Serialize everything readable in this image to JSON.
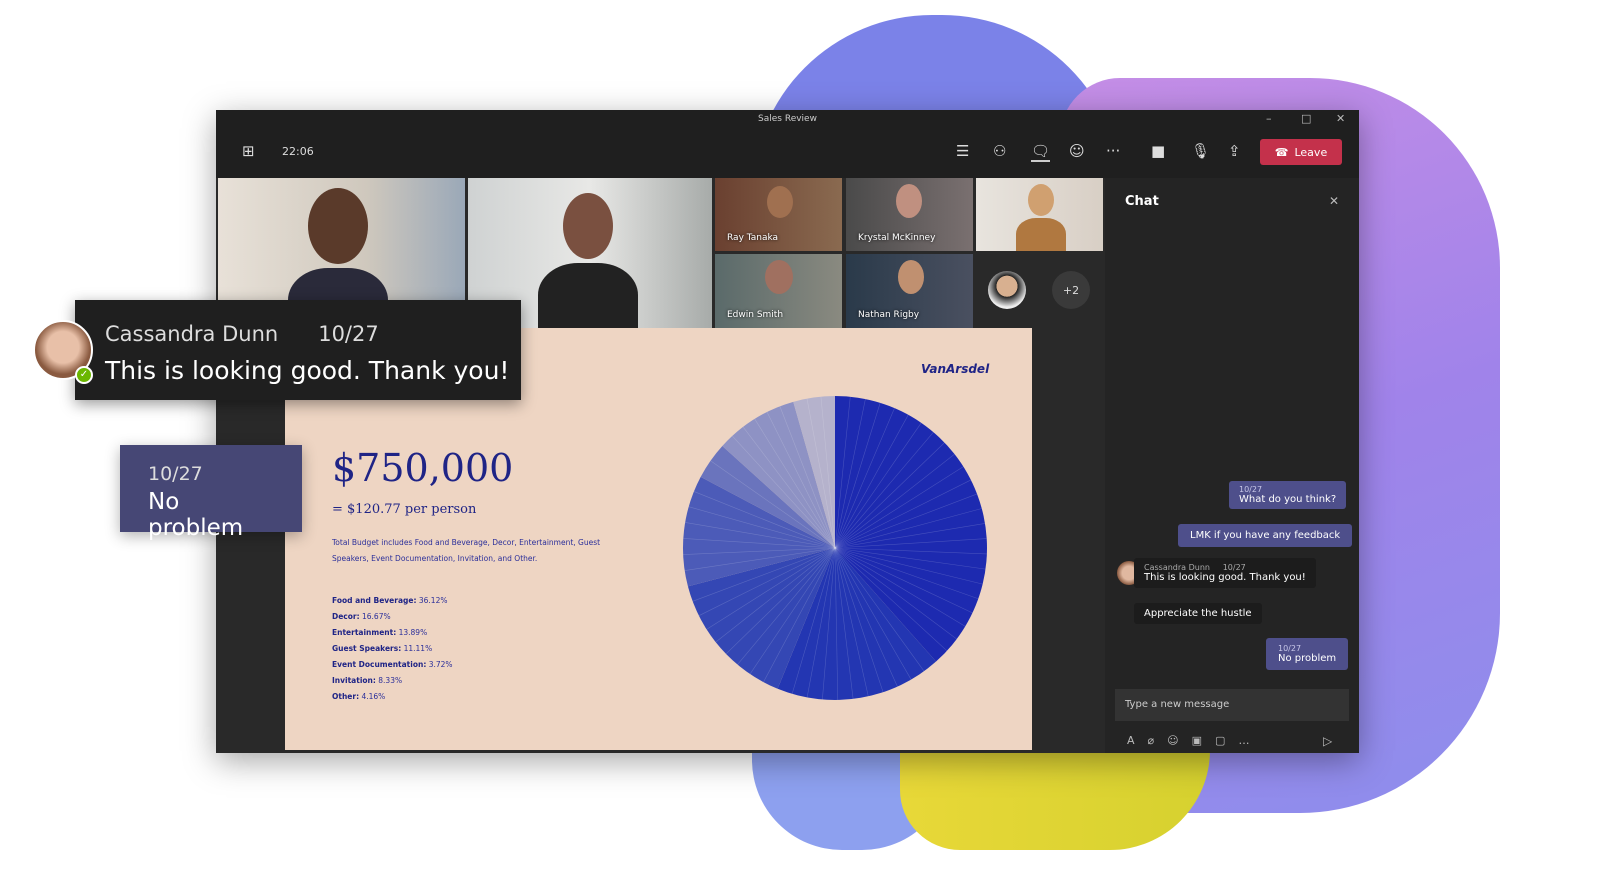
{
  "window": {
    "title": "Sales Review",
    "minimize": "–",
    "maximize": "□",
    "close": "✕"
  },
  "toolbar": {
    "timer": "22:06",
    "leave_label": "Leave",
    "more": "···"
  },
  "participants": [
    {
      "name": ""
    },
    {
      "name": ""
    },
    {
      "name": "Ray Tanaka"
    },
    {
      "name": "Krystal McKinney"
    },
    {
      "name": ""
    },
    {
      "name": "Edwin Smith"
    },
    {
      "name": "Nathan Rigby"
    }
  ],
  "overflow_count": "+2",
  "slide": {
    "brand": "VanArsdel",
    "total": "$750,000",
    "per_person": "= $120.77 per person",
    "description": "Total Budget includes Food and Beverage, Decor, Entertainment, Guest Speakers, Event Documentation, Invitation, and Other.",
    "legend": [
      {
        "label": "Food and Beverage:",
        "value": "36.12%"
      },
      {
        "label": "Decor:",
        "value": "16.67%"
      },
      {
        "label": "Entertainment:",
        "value": "13.89%"
      },
      {
        "label": "Guest Speakers:",
        "value": "11.11%"
      },
      {
        "label": "Event Documentation:",
        "value": "3.72%"
      },
      {
        "label": "Invitation:",
        "value": "8.33%"
      },
      {
        "label": "Other:",
        "value": "4.16%"
      }
    ]
  },
  "chart_data": {
    "type": "pie",
    "categories": [
      "Food and Beverage",
      "Decor",
      "Entertainment",
      "Guest Speakers",
      "Event Documentation",
      "Invitation",
      "Other"
    ],
    "values": [
      36.12,
      16.67,
      13.89,
      11.11,
      3.72,
      8.33,
      4.16
    ],
    "colors": [
      "#1d2ab0",
      "#2336b2",
      "#3447b4",
      "#4c5bb8",
      "#6a74bd",
      "#8e92c4",
      "#b5b2cc"
    ]
  },
  "chat": {
    "title": "Chat",
    "messages": [
      {
        "date": "10/27",
        "text": "What do you think?"
      },
      {
        "text": "LMK if you have any feedback"
      },
      {
        "author": "Cassandra Dunn",
        "date": "10/27",
        "text": "This is looking good. Thank you!"
      },
      {
        "text": "Appreciate the hustle"
      },
      {
        "date": "10/27",
        "text": "No problem"
      }
    ],
    "input_placeholder": "Type a new message"
  },
  "toast": {
    "author": "Cassandra Dunn",
    "date": "10/27",
    "text": "This is looking good. Thank you!"
  },
  "reply_card": {
    "date": "10/27",
    "text": "No problem"
  }
}
